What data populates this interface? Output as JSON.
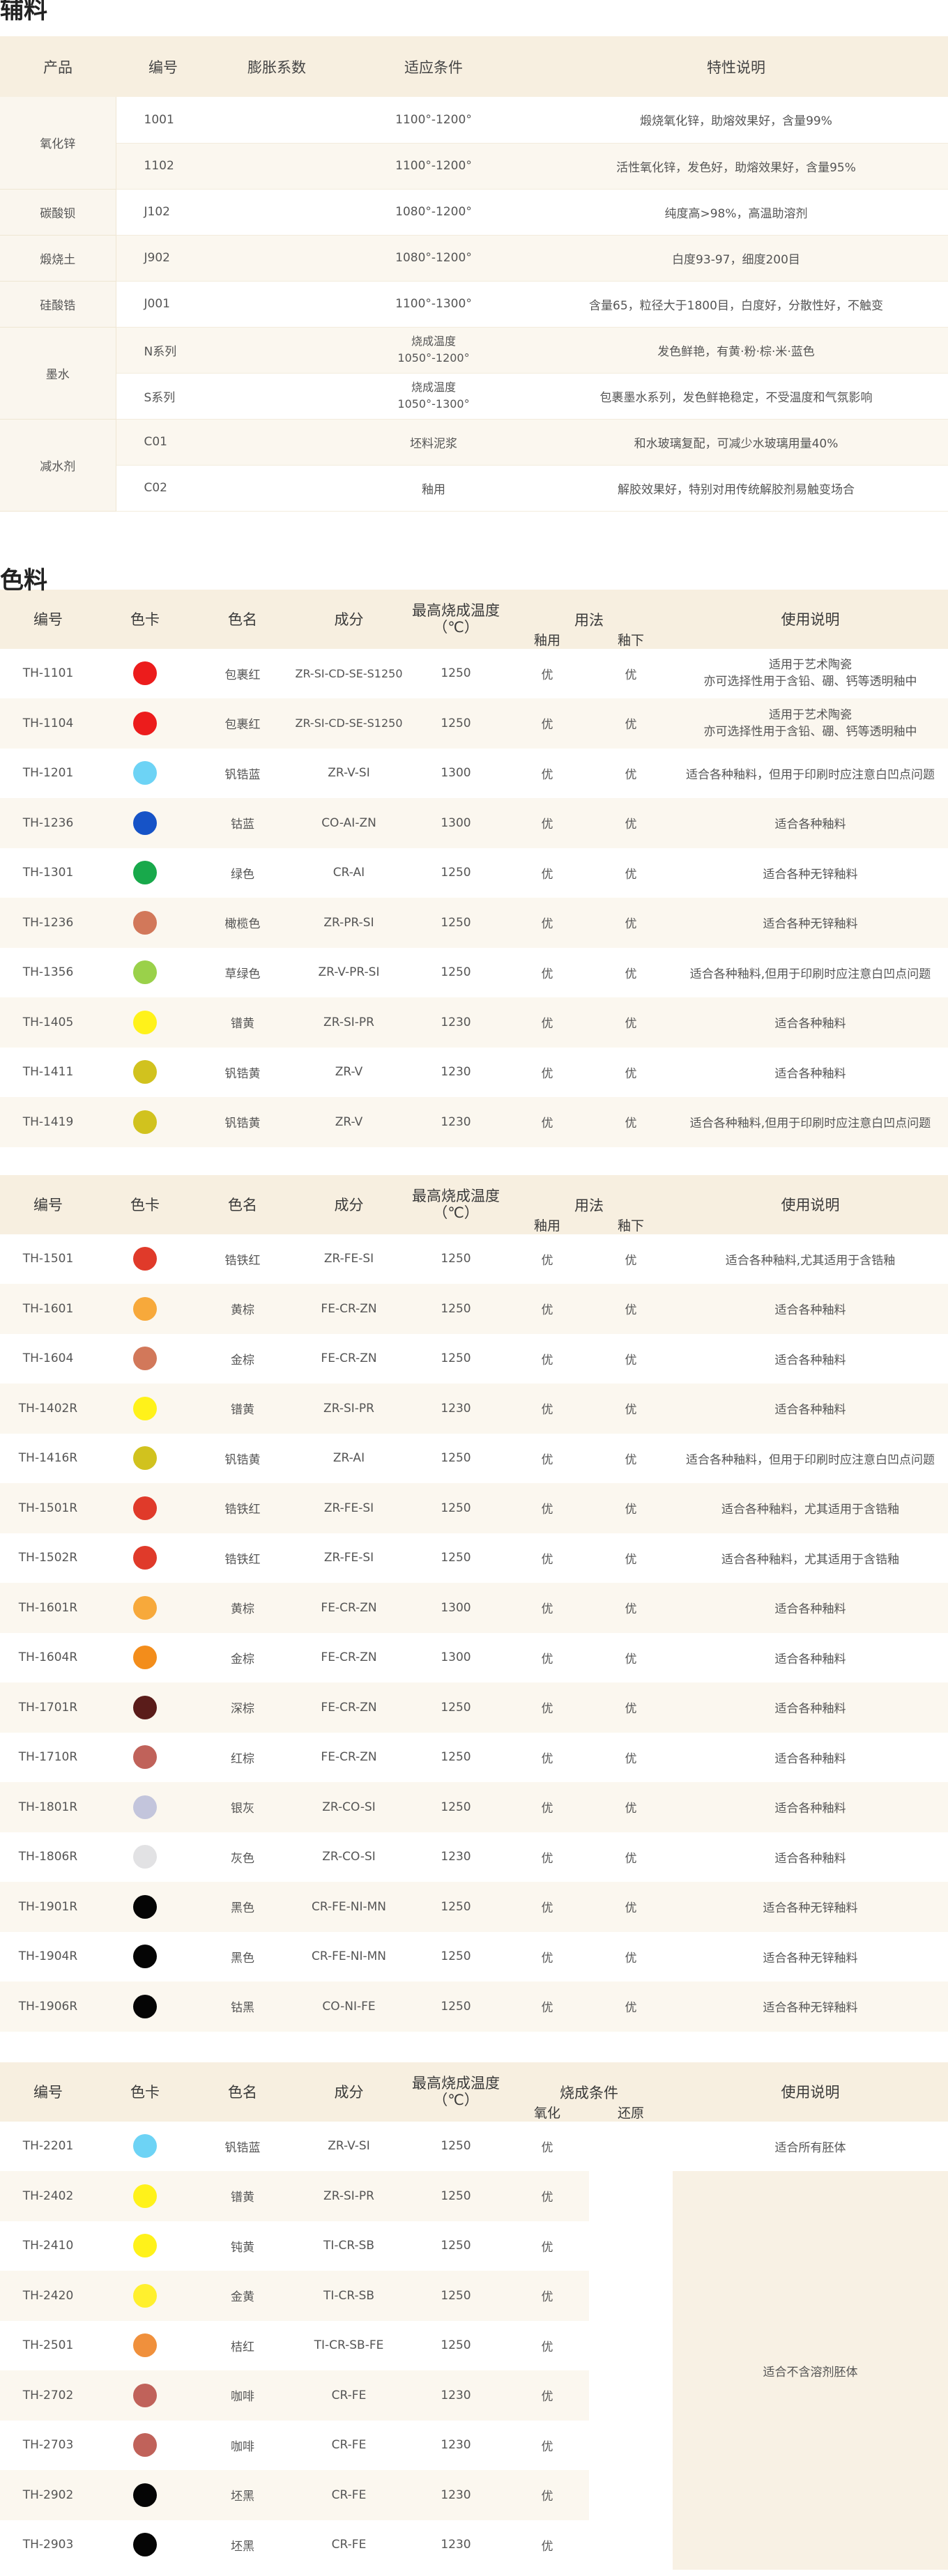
{
  "aux": {
    "title": "辅料",
    "headers": [
      "产品",
      "编号",
      "膨胀系数",
      "适应条件",
      "特性说明"
    ],
    "groups": [
      {
        "product": "氧化锌",
        "rows": [
          {
            "code": "1001",
            "cond": "1100°-1200°",
            "desc": "煅烧氧化锌，助熔效果好，含量99%"
          },
          {
            "code": "1102",
            "cond": "1100°-1200°",
            "desc": "活性氧化锌，发色好，助熔效果好，含量95%"
          }
        ]
      },
      {
        "product": "碳酸钡",
        "rows": [
          {
            "code": "J102",
            "cond": "1080°-1200°",
            "desc": "纯度高>98%，高温助溶剂"
          }
        ]
      },
      {
        "product": "煅烧土",
        "rows": [
          {
            "code": "J902",
            "cond": "1080°-1200°",
            "desc": "白度93-97，细度200目"
          }
        ]
      },
      {
        "product": "硅酸锆",
        "rows": [
          {
            "code": "J001",
            "cond": "1100°-1300°",
            "desc": "含量65，粒径大于1800目，白度好，分散性好，不触变"
          }
        ]
      },
      {
        "product": "墨水",
        "rows": [
          {
            "code": "N系列",
            "cond": "烧成温度\n1050°-1200°",
            "desc": "发色鲜艳，有黄·粉·棕·米·蓝色"
          },
          {
            "code": "S系列",
            "cond": "烧成温度\n1050°-1300°",
            "desc": "包裹墨水系列，发色鲜艳稳定，不受温度和气氛影响"
          }
        ]
      },
      {
        "product": "减水剂",
        "rows": [
          {
            "code": "C01",
            "cond": "坯料泥浆",
            "desc": "和水玻璃复配，可减少水玻璃用量40%"
          },
          {
            "code": "C02",
            "cond": "釉用",
            "desc": "解胶效果好，特别对用传统解胶剂易触变场合"
          }
        ]
      }
    ]
  },
  "colorant": {
    "title": "色料",
    "headers": {
      "code": "编号",
      "card": "色卡",
      "name": "色名",
      "comp": "成分",
      "temp": "最高烧成温度\n（℃）",
      "usage": "用法",
      "glaze_in": "釉用",
      "glaze_under": "釉下",
      "note": "使用说明"
    },
    "headers3": {
      "code": "编号",
      "card": "色卡",
      "name": "色名",
      "comp": "成分",
      "temp": "最高烧成温度\n（℃）",
      "fire": "烧成条件",
      "ox": "氧化",
      "red": "还原",
      "note": "使用说明"
    },
    "table1": [
      {
        "code": "TH-1101",
        "color": "#ec1c1c",
        "name": "包裹红",
        "comp": "ZR-SI-CD-SE-S1250",
        "temp": "1250",
        "a": "优",
        "b": "优",
        "note": "适用于艺术陶瓷\n亦可选择性用于含铅、硼、钙等透明釉中"
      },
      {
        "code": "TH-1104",
        "color": "#ec1c1c",
        "name": "包裹红",
        "comp": "ZR-SI-CD-SE-S1250",
        "temp": "1250",
        "a": "优",
        "b": "优",
        "note": "适用于艺术陶瓷\n亦可选择性用于含铅、硼、钙等透明釉中"
      },
      {
        "code": "TH-1201",
        "color": "#6dd3f5",
        "name": "钒锆蓝",
        "comp": "ZR-V-SI",
        "temp": "1300",
        "a": "优",
        "b": "优",
        "note": "适合各种釉料，但用于印刷时应注意白凹点问题"
      },
      {
        "code": "TH-1236",
        "color": "#1653c7",
        "name": "钴蓝",
        "comp": "CO-AI-ZN",
        "temp": "1300",
        "a": "优",
        "b": "优",
        "note": "适合各种釉料"
      },
      {
        "code": "TH-1301",
        "color": "#18a94b",
        "name": "绿色",
        "comp": "CR-AI",
        "temp": "1250",
        "a": "优",
        "b": "优",
        "note": "适合各种无锌釉料"
      },
      {
        "code": "TH-1236",
        "color": "#d2785a",
        "name": "橄榄色",
        "comp": "ZR-PR-SI",
        "temp": "1250",
        "a": "优",
        "b": "优",
        "note": "适合各种无锌釉料"
      },
      {
        "code": "TH-1356",
        "color": "#9ad14a",
        "name": "草绿色",
        "comp": "ZR-V-PR-SI",
        "temp": "1250",
        "a": "优",
        "b": "优",
        "note": "适合各种釉料,但用于印刷时应注意白凹点问题"
      },
      {
        "code": "TH-1405",
        "color": "#fff21a",
        "name": "镨黄",
        "comp": "ZR-SI-PR",
        "temp": "1230",
        "a": "优",
        "b": "优",
        "note": "适合各种釉料"
      },
      {
        "code": "TH-1411",
        "color": "#d1c21e",
        "name": "钒锆黄",
        "comp": "ZR-V",
        "temp": "1230",
        "a": "优",
        "b": "优",
        "note": "适合各种釉料"
      },
      {
        "code": "TH-1419",
        "color": "#d1c21e",
        "name": "钒锆黄",
        "comp": "ZR-V",
        "temp": "1230",
        "a": "优",
        "b": "优",
        "note": "适合各种釉料,但用于印刷时应注意白凹点问题"
      }
    ],
    "table2": [
      {
        "code": "TH-1501",
        "color": "#e03a2a",
        "name": "锆铁红",
        "comp": "ZR-FE-SI",
        "temp": "1250",
        "a": "优",
        "b": "优",
        "note": "适合各种釉料,尤其适用于含锆釉"
      },
      {
        "code": "TH-1601",
        "color": "#f7a93b",
        "name": "黄棕",
        "comp": "FE-CR-ZN",
        "temp": "1250",
        "a": "优",
        "b": "优",
        "note": "适合各种釉料"
      },
      {
        "code": "TH-1604",
        "color": "#d2785a",
        "name": "金棕",
        "comp": "FE-CR-ZN",
        "temp": "1250",
        "a": "优",
        "b": "优",
        "note": "适合各种釉料"
      },
      {
        "code": "TH-1402R",
        "color": "#fff21a",
        "name": "镨黄",
        "comp": "ZR-SI-PR",
        "temp": "1230",
        "a": "优",
        "b": "优",
        "note": "适合各种釉料"
      },
      {
        "code": "TH-1416R",
        "color": "#d1c21e",
        "name": "钒锆黄",
        "comp": "ZR-AI",
        "temp": "1250",
        "a": "优",
        "b": "优",
        "note": "适合各种釉料，但用于印刷时应注意白凹点问题"
      },
      {
        "code": "TH-1501R",
        "color": "#e03a2a",
        "name": "锆铁红",
        "comp": "ZR-FE-SI",
        "temp": "1250",
        "a": "优",
        "b": "优",
        "note": "适合各种釉料，尤其适用于含锆釉"
      },
      {
        "code": "TH-1502R",
        "color": "#e03a2a",
        "name": "锆铁红",
        "comp": "ZR-FE-SI",
        "temp": "1250",
        "a": "优",
        "b": "优",
        "note": "适合各种釉料，尤其适用于含锆釉"
      },
      {
        "code": "TH-1601R",
        "color": "#f7a93b",
        "name": "黄棕",
        "comp": "FE-CR-ZN",
        "temp": "1300",
        "a": "优",
        "b": "优",
        "note": "适合各种釉料"
      },
      {
        "code": "TH-1604R",
        "color": "#f38d1b",
        "name": "金棕",
        "comp": "FE-CR-ZN",
        "temp": "1300",
        "a": "优",
        "b": "优",
        "note": "适合各种釉料"
      },
      {
        "code": "TH-1701R",
        "color": "#5a1c1a",
        "name": "深棕",
        "comp": "FE-CR-ZN",
        "temp": "1250",
        "a": "优",
        "b": "优",
        "note": "适合各种釉料"
      },
      {
        "code": "TH-1710R",
        "color": "#c0625a",
        "name": "红棕",
        "comp": "FE-CR-ZN",
        "temp": "1250",
        "a": "优",
        "b": "优",
        "note": "适合各种釉料"
      },
      {
        "code": "TH-1801R",
        "color": "#c3c5dc",
        "name": "银灰",
        "comp": "ZR-CO-SI",
        "temp": "1250",
        "a": "优",
        "b": "优",
        "note": "适合各种釉料"
      },
      {
        "code": "TH-1806R",
        "color": "#e2e2e4",
        "name": "灰色",
        "comp": "ZR-CO-SI",
        "temp": "1230",
        "a": "优",
        "b": "优",
        "note": "适合各种釉料"
      },
      {
        "code": "TH-1901R",
        "color": "#050505",
        "name": "黑色",
        "comp": "CR-FE-NI-MN",
        "temp": "1250",
        "a": "优",
        "b": "优",
        "note": "适合各种无锌釉料"
      },
      {
        "code": "TH-1904R",
        "color": "#050505",
        "name": "黑色",
        "comp": "CR-FE-NI-MN",
        "temp": "1250",
        "a": "优",
        "b": "优",
        "note": "适合各种无锌釉料"
      },
      {
        "code": "TH-1906R",
        "color": "#050505",
        "name": "钴黑",
        "comp": "CO-NI-FE",
        "temp": "1250",
        "a": "优",
        "b": "优",
        "note": "适合各种无锌釉料"
      }
    ],
    "table3": [
      {
        "code": "TH-2201",
        "color": "#6dd3f5",
        "name": "钒锆蓝",
        "comp": "ZR-V-SI",
        "temp": "1250",
        "ox": "优",
        "red": ""
      },
      {
        "code": "TH-2402",
        "color": "#fff21a",
        "name": "镨黄",
        "comp": "ZR-SI-PR",
        "temp": "1250",
        "ox": "优",
        "red": ""
      },
      {
        "code": "TH-2410",
        "color": "#fff21a",
        "name": "钝黄",
        "comp": "TI-CR-SB",
        "temp": "1250",
        "ox": "优",
        "red": ""
      },
      {
        "code": "TH-2420",
        "color": "#fff02e",
        "name": "金黄",
        "comp": "TI-CR-SB",
        "temp": "1250",
        "ox": "优",
        "red": ""
      },
      {
        "code": "TH-2501",
        "color": "#f0903c",
        "name": "桔红",
        "comp": "TI-CR-SB-FE",
        "temp": "1250",
        "ox": "优",
        "red": ""
      },
      {
        "code": "TH-2702",
        "color": "#c0625a",
        "name": "咖啡",
        "comp": "CR-FE",
        "temp": "1230",
        "ox": "优",
        "red": ""
      },
      {
        "code": "TH-2703",
        "color": "#c0625a",
        "name": "咖啡",
        "comp": "CR-FE",
        "temp": "1230",
        "ox": "优",
        "red": ""
      },
      {
        "code": "TH-2902",
        "color": "#050505",
        "name": "坯黑",
        "comp": "CR-FE",
        "temp": "1230",
        "ox": "优",
        "red": ""
      },
      {
        "code": "TH-2903",
        "color": "#050505",
        "name": "坯黑",
        "comp": "CR-FE",
        "temp": "1230",
        "ox": "优",
        "red": ""
      }
    ],
    "table3_first_note": "适合所有胚体",
    "table3_merged_note": "适合不含溶剂胚体"
  }
}
